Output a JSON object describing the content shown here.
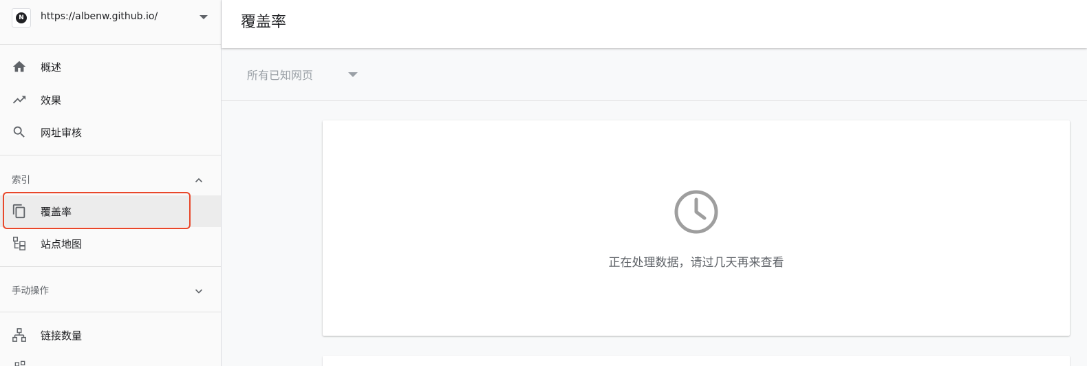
{
  "property": {
    "icon_letter": "N",
    "url": "https://albenw.github.io/"
  },
  "sidebar": {
    "top_items": [
      {
        "label": "概述",
        "icon": "home-icon"
      },
      {
        "label": "效果",
        "icon": "trending-up-icon"
      },
      {
        "label": "网址审核",
        "icon": "search-icon"
      }
    ],
    "index_section": {
      "label": "索引",
      "expanded": true,
      "items": [
        {
          "label": "覆盖率",
          "icon": "copy-pages-icon",
          "active": true
        },
        {
          "label": "站点地图",
          "icon": "sitemap-icon",
          "active": false
        }
      ]
    },
    "manual_section": {
      "label": "手动操作",
      "expanded": false
    },
    "bottom_items": [
      {
        "label": "链接数量",
        "icon": "links-icon"
      }
    ]
  },
  "main": {
    "title": "覆盖率",
    "filter": {
      "selected": "所有已知网页"
    },
    "status_message": "正在处理数据，请过几天再来查看",
    "status_icon": "clock-icon"
  },
  "colors": {
    "highlight_border": "#e8472a",
    "active_bg": "#ececec",
    "icon_gray": "#9e9e9e"
  }
}
